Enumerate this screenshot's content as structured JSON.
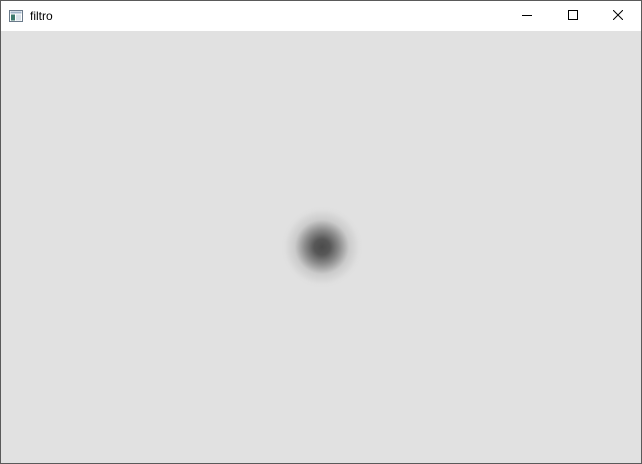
{
  "window": {
    "title": "filtro",
    "app_icon": "app-window-icon",
    "controls": {
      "minimize_icon": "minimize-icon",
      "maximize_icon": "maximize-icon",
      "close_icon": "close-icon"
    }
  },
  "canvas": {
    "background_color": "#e1e1e1",
    "blob_color": "#4b4b4b",
    "blob_shape": "blurred dark circle"
  }
}
